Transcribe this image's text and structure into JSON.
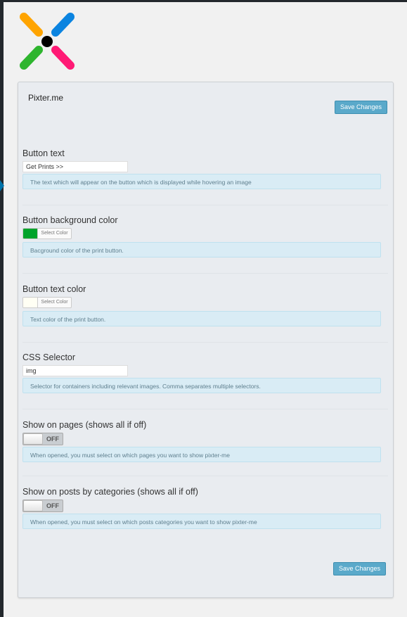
{
  "plugin": {
    "title": "Pixter.me",
    "save_label": "Save Changes"
  },
  "colors": {
    "logo_orange": "#ffa400",
    "logo_blue": "#0b84e0",
    "logo_green": "#2eb52e",
    "logo_pink": "#ff1a75",
    "button_bg": "#00a32a",
    "button_text": "#fffff4"
  },
  "fields": {
    "button_text": {
      "label": "Button text",
      "value": "Get Prints >>",
      "help": "The text which will appear on the button which is displayed while hovering an image"
    },
    "button_bg_color": {
      "label": "Button background color",
      "picker_label": "Select Color",
      "help": "Bacground color of the print button."
    },
    "button_text_color": {
      "label": "Button text color",
      "picker_label": "Select Color",
      "help": "Text color of the print button."
    },
    "css_selector": {
      "label": "CSS Selector",
      "value": "img",
      "help": "Selector for containers including relevant images. Comma separates multiple selectors."
    },
    "show_on_pages": {
      "label": "Show on pages (shows all if off)",
      "toggle_state": "OFF",
      "help": "When opened, you must select on which pages you want to show pixter-me"
    },
    "show_on_posts": {
      "label": "Show on posts by categories (shows all if off)",
      "toggle_state": "OFF",
      "help": "When opened, you must select on which posts categories you want to show pixter-me"
    }
  }
}
